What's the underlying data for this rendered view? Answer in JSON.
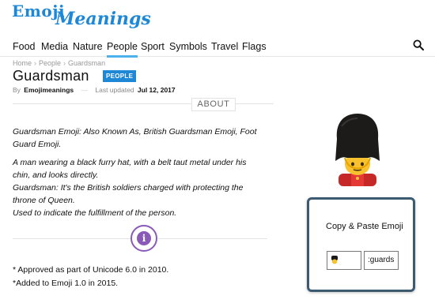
{
  "logo": {
    "word1": "Emoji",
    "word2": "Meanings"
  },
  "nav": {
    "items": [
      "Food",
      "Media",
      "Nature",
      "People",
      "Sport",
      "Symbols",
      "Travel",
      "Flags"
    ],
    "active": "People"
  },
  "breadcrumb": {
    "home": "Home",
    "section": "People",
    "current": "Guardsman"
  },
  "page": {
    "title": "Guardsman",
    "category_badge": "PEOPLE",
    "by_prefix": "By",
    "author": "Emojimeanings",
    "updated_prefix": "Last updated",
    "updated_date": "Jul 12, 2017"
  },
  "about_tab": "ABOUT",
  "body": {
    "p1": "Guardsman Emoji: Also Known As, British Guardsman Emoji, Foot Guard Emoji.",
    "p2": [
      "A man wearing a black furry hat, with a belt taut metal under his chin, and looks directly.",
      "Guardsman: It's the British soldiers charged with protecting the throne of Queen.",
      "Used to indicate the fulfillment of the person."
    ]
  },
  "notes": [
    "* Approved as part of Unicode 6.0 in 2010.",
    "*Added to Emoji 1.0 in 2015."
  ],
  "copy_box": {
    "title": "Copy & Paste Emoji",
    "shortcode_value": ":guards"
  },
  "icons": {
    "search": "search-icon",
    "info": "info-icon",
    "emoji": "guardsman-emoji-icon"
  },
  "colors": {
    "brand": "#1e88d6",
    "nav_active": "#4db2ec",
    "info": "#8a5ab8",
    "copy_border": "#3c5a70"
  }
}
